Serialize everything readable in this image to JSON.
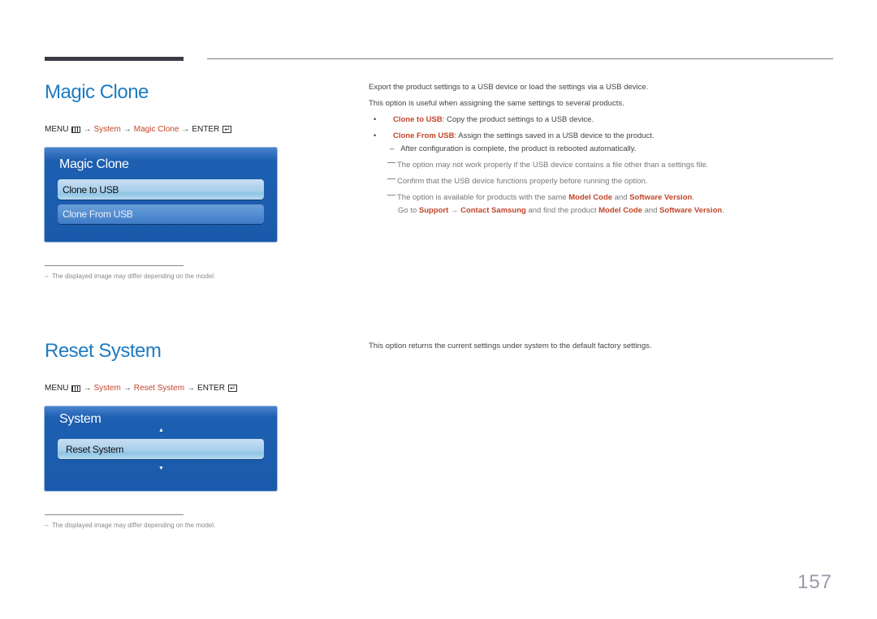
{
  "page_number": "157",
  "magic_clone": {
    "title": "Magic Clone",
    "menu_path": {
      "menu": "MENU",
      "arrow": "→",
      "step1": "System",
      "step2": "Magic Clone",
      "enter": "ENTER",
      "enter_glyph": "↵"
    },
    "osd": {
      "title": "Magic Clone",
      "items": [
        {
          "label": "Clone to USB",
          "state": "selected"
        },
        {
          "label": "Clone From USB",
          "state": "normal"
        }
      ]
    },
    "footnote": "The displayed image may differ depending on the model.",
    "description": {
      "line1": "Export the product settings to a USB device or load the settings via a USB device.",
      "line2": "This option is useful when assigning the same settings to several products.",
      "bullets": [
        {
          "term": "Clone to USB",
          "text": ": Copy the product settings to a USB device."
        },
        {
          "term": "Clone From USB",
          "text": ": Assign the settings saved in a USB device to the product."
        }
      ],
      "sub_note": "After configuration is complete, the product is rebooted automatically.",
      "notes": [
        "The option may not work properly if the USB device contains a file other than a settings file.",
        "Confirm that the USB device functions properly before running the option."
      ],
      "note3": {
        "pre": "The option is available for products with the same ",
        "term1": "Model Code",
        "mid": " and ",
        "term2": "Software Version",
        "end": "."
      },
      "note4": {
        "pre": "Go to ",
        "term1": "Support",
        "arrow": " → ",
        "term2": "Contact Samsung",
        "mid": " and find the product ",
        "term3": "Model Code",
        "and": " and ",
        "term4": "Software Version",
        "end": "."
      }
    }
  },
  "reset_system": {
    "title": "Reset System",
    "menu_path": {
      "menu": "MENU",
      "arrow": "→",
      "step1": "System",
      "step2": "Reset System",
      "enter": "ENTER",
      "enter_glyph": "↵"
    },
    "osd": {
      "title": "System",
      "up_arrow": "▲",
      "down_arrow": "▼",
      "items": [
        {
          "label": "Reset System",
          "state": "selected"
        }
      ]
    },
    "footnote": "The displayed image may differ depending on the model.",
    "description": "This option returns the current settings under system to the default factory settings."
  },
  "dash": "–"
}
